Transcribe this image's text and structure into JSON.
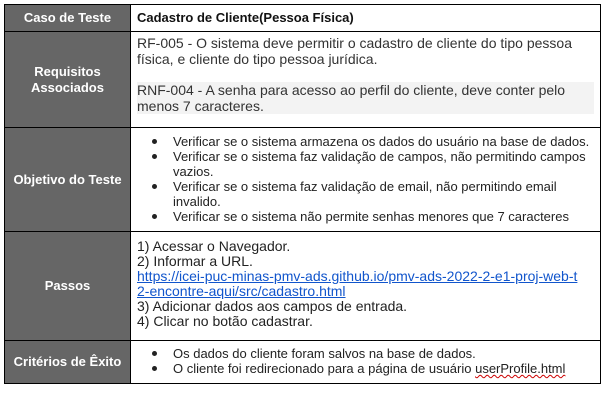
{
  "rows": {
    "caso": {
      "label": "Caso de Teste",
      "value": "Cadastro de Cliente(Pessoa Física)"
    },
    "requisitos": {
      "label_line1": "Requisitos",
      "label_line2": "Associados",
      "paragraphs": [
        "RF-005 - O sistema deve permitir o cadastro de cliente do tipo pessoa física, e cliente do tipo pessoa jurídica.",
        "RNF-004 - A senha para acesso ao perfil do cliente, deve conter pelo menos 7 caracteres."
      ]
    },
    "objetivo": {
      "label": "Objetivo do Teste",
      "items": [
        "Verificar se o sistema armazena os dados do usuário na base de dados.",
        "Verificar se o sistema faz validação de campos, não permitindo campos vazios.",
        "Verificar se o sistema faz validação de email, não permitindo email invalido.",
        "Verificar se o sistema não permite senhas menores que 7 caracteres"
      ]
    },
    "passos": {
      "label": "Passos",
      "step1": "1) Acessar o Navegador.",
      "step2": "2) Informar a URL.",
      "url_line1": "https://icei-puc-minas-pmv-ads.github.io/pmv-ads-2022-2-e1-proj-web-t",
      "url_line2": "2-encontre-aqui/src/cadastro.html",
      "step3": "3) Adicionar dados aos campos de entrada.",
      "step4": "4) Clicar no botão cadastrar."
    },
    "criterios": {
      "label": "Critérios de Êxito",
      "item1": "Os dados do cliente foram salvos na base de dados.",
      "item2_prefix": "O cliente foi redirecionado para a página de usuário ",
      "item2_file": "userProfile.html"
    }
  },
  "colors": {
    "label_bg": "#666666",
    "label_text": "#ffffff",
    "link": "#1155cc",
    "highlight_bg": "#f3f3f3"
  }
}
